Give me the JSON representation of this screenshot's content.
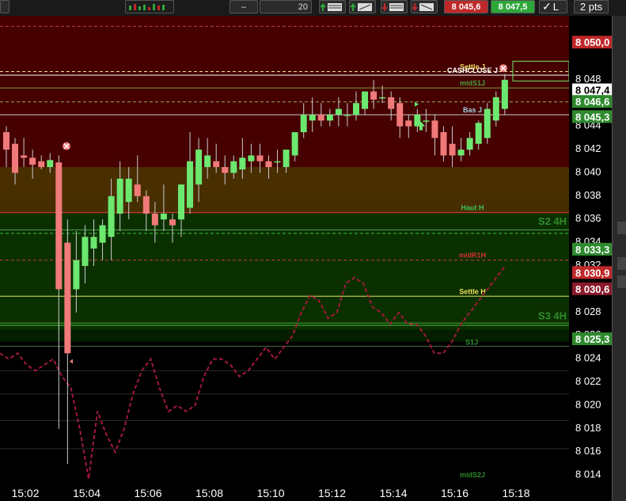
{
  "toolbar": {
    "qty_label": "20",
    "sell_price": "8 045,6",
    "buy_price": "8 047,5",
    "check_label": "L",
    "pts_label": "2 pts"
  },
  "chart_data": {
    "type": "candlestick",
    "ylim": [
      8012,
      8052
    ],
    "y_ticks": [
      8014,
      8016,
      8018,
      8020,
      8022,
      8024,
      8026,
      8028,
      8030,
      8032,
      8034,
      8036,
      8038,
      8040,
      8042,
      8044,
      8046,
      8048
    ],
    "y_tick_labels": [
      "8 014",
      "8 016",
      "8 018",
      "8 020",
      "8 022",
      "8 024",
      "8 026",
      "8 028",
      "8 030",
      "8 032",
      "8 034",
      "8 036",
      "8 038",
      "8 040",
      "8 042",
      "8 044",
      "8 046",
      "8 048"
    ],
    "x_time_labels": [
      {
        "label": "15:02",
        "t": 15.02
      },
      {
        "label": "15:04",
        "t": 15.04
      },
      {
        "label": "15:06",
        "t": 15.06
      },
      {
        "label": "15:08",
        "t": 15.08
      },
      {
        "label": "15:10",
        "t": 15.1
      },
      {
        "label": "15:12",
        "t": 15.12
      },
      {
        "label": "15:14",
        "t": 15.14
      },
      {
        "label": "15:16",
        "t": 15.16
      },
      {
        "label": "15:18",
        "t": 15.18
      }
    ],
    "candles": [
      {
        "o": 8042.0,
        "h": 8042.5,
        "l": 8039.0,
        "c": 8040.5
      },
      {
        "o": 8041.0,
        "h": 8041.5,
        "l": 8037.5,
        "c": 8038.5
      },
      {
        "o": 8040.0,
        "h": 8041.5,
        "l": 8039.0,
        "c": 8039.8
      },
      {
        "o": 8039.8,
        "h": 8040.5,
        "l": 8038.0,
        "c": 8039.2
      },
      {
        "o": 8039.5,
        "h": 8040.0,
        "l": 8038.8,
        "c": 8039.0
      },
      {
        "o": 8039.0,
        "h": 8040.2,
        "l": 8038.5,
        "c": 8039.6
      },
      {
        "o": 8039.4,
        "h": 8040.0,
        "l": 8016.5,
        "c": 8028.5
      },
      {
        "o": 8032.5,
        "h": 8034.5,
        "l": 8013.5,
        "c": 8023.0
      },
      {
        "o": 8028.5,
        "h": 8033.5,
        "l": 8026.5,
        "c": 8031.0
      },
      {
        "o": 8030.5,
        "h": 8034.0,
        "l": 8029.0,
        "c": 8033.0
      },
      {
        "o": 8032.0,
        "h": 8034.5,
        "l": 8030.5,
        "c": 8033.0
      },
      {
        "o": 8032.5,
        "h": 8034.5,
        "l": 8031.0,
        "c": 8034.0
      },
      {
        "o": 8033.0,
        "h": 8038.0,
        "l": 8031.0,
        "c": 8036.5
      },
      {
        "o": 8035.0,
        "h": 8039.5,
        "l": 8033.5,
        "c": 8038.0
      },
      {
        "o": 8036.0,
        "h": 8039.0,
        "l": 8034.5,
        "c": 8038.0
      },
      {
        "o": 8037.5,
        "h": 8040.0,
        "l": 8036.0,
        "c": 8036.5
      },
      {
        "o": 8036.5,
        "h": 8037.0,
        "l": 8033.5,
        "c": 8035.0
      },
      {
        "o": 8035.0,
        "h": 8036.0,
        "l": 8032.5,
        "c": 8034.0
      },
      {
        "o": 8034.5,
        "h": 8037.5,
        "l": 8033.5,
        "c": 8035.0
      },
      {
        "o": 8034.5,
        "h": 8035.0,
        "l": 8032.5,
        "c": 8034.0
      },
      {
        "o": 8034.5,
        "h": 8037.5,
        "l": 8033.0,
        "c": 8037.5
      },
      {
        "o": 8035.5,
        "h": 8042.0,
        "l": 8035.0,
        "c": 8039.5
      },
      {
        "o": 8037.5,
        "h": 8041.5,
        "l": 8036.0,
        "c": 8040.5
      },
      {
        "o": 8039.0,
        "h": 8041.5,
        "l": 8038.0,
        "c": 8040.0
      },
      {
        "o": 8039.5,
        "h": 8041.0,
        "l": 8038.5,
        "c": 8039.0
      },
      {
        "o": 8039.0,
        "h": 8040.0,
        "l": 8037.5,
        "c": 8038.5
      },
      {
        "o": 8038.5,
        "h": 8040.0,
        "l": 8038.0,
        "c": 8039.5
      },
      {
        "o": 8038.8,
        "h": 8041.5,
        "l": 8038.0,
        "c": 8039.8
      },
      {
        "o": 8039.5,
        "h": 8041.0,
        "l": 8038.5,
        "c": 8040.0
      },
      {
        "o": 8040.0,
        "h": 8041.0,
        "l": 8038.5,
        "c": 8039.5
      },
      {
        "o": 8039.5,
        "h": 8040.0,
        "l": 8038.0,
        "c": 8039.0
      },
      {
        "o": 8039.5,
        "h": 8040.5,
        "l": 8038.5,
        "c": 8039.5
      },
      {
        "o": 8039.0,
        "h": 8040.5,
        "l": 8038.5,
        "c": 8040.5
      },
      {
        "o": 8040.0,
        "h": 8042.0,
        "l": 8039.5,
        "c": 8042.0
      },
      {
        "o": 8042.0,
        "h": 8044.5,
        "l": 8041.5,
        "c": 8043.5
      },
      {
        "o": 8043.0,
        "h": 8045.0,
        "l": 8042.0,
        "c": 8043.5
      },
      {
        "o": 8043.5,
        "h": 8044.5,
        "l": 8042.5,
        "c": 8043.0
      },
      {
        "o": 8043.0,
        "h": 8044.0,
        "l": 8042.5,
        "c": 8043.5
      },
      {
        "o": 8043.5,
        "h": 8045.0,
        "l": 8042.5,
        "c": 8044.0
      },
      {
        "o": 8043.5,
        "h": 8044.5,
        "l": 8042.5,
        "c": 8043.5
      },
      {
        "o": 8043.5,
        "h": 8045.5,
        "l": 8043.0,
        "c": 8044.5
      },
      {
        "o": 8044.0,
        "h": 8045.5,
        "l": 8043.5,
        "c": 8045.5
      },
      {
        "o": 8045.5,
        "h": 8046.5,
        "l": 8044.0,
        "c": 8044.8
      },
      {
        "o": 8045.0,
        "h": 8046.0,
        "l": 8044.5,
        "c": 8045.0
      },
      {
        "o": 8045.0,
        "h": 8045.5,
        "l": 8043.0,
        "c": 8044.0
      },
      {
        "o": 8044.5,
        "h": 8045.0,
        "l": 8041.5,
        "c": 8042.5
      },
      {
        "o": 8043.0,
        "h": 8043.5,
        "l": 8041.5,
        "c": 8042.5
      },
      {
        "o": 8042.5,
        "h": 8044.0,
        "l": 8042.0,
        "c": 8043.5
      },
      {
        "o": 8043.0,
        "h": 8044.0,
        "l": 8042.0,
        "c": 8043.0
      },
      {
        "o": 8043.0,
        "h": 8043.5,
        "l": 8040.0,
        "c": 8041.5
      },
      {
        "o": 8042.0,
        "h": 8042.5,
        "l": 8039.5,
        "c": 8040.0
      },
      {
        "o": 8041.0,
        "h": 8042.5,
        "l": 8039.0,
        "c": 8040.0
      },
      {
        "o": 8040.0,
        "h": 8041.5,
        "l": 8039.5,
        "c": 8040.5
      },
      {
        "o": 8040.5,
        "h": 8042.0,
        "l": 8040.0,
        "c": 8041.5
      },
      {
        "o": 8041.0,
        "h": 8043.0,
        "l": 8040.5,
        "c": 8042.8
      },
      {
        "o": 8041.5,
        "h": 8044.5,
        "l": 8041.0,
        "c": 8044.0
      },
      {
        "o": 8043.0,
        "h": 8045.5,
        "l": 8042.5,
        "c": 8045.0
      },
      {
        "o": 8044.0,
        "h": 8047.0,
        "l": 8043.5,
        "c": 8046.5
      }
    ],
    "dashed_indicator": [
      8023,
      8022.5,
      8023,
      8022,
      8021.5,
      8022,
      8022.5,
      8021,
      8020,
      8016.5,
      8012.2,
      8018,
      8016,
      8014.5,
      8016.5,
      8019.5,
      8021.5,
      8022.5,
      8020,
      8018,
      8018.5,
      8018,
      8018.5,
      8021,
      8022.5,
      8022.5,
      8022,
      8021,
      8021.5,
      8022.5,
      8023.5,
      8022.5,
      8023.5,
      8024.5,
      8026.5,
      8028,
      8027.5,
      8026,
      8026.5,
      8029,
      8029.5,
      8029,
      8027,
      8026.5,
      8025.5,
      8026.5,
      8025.5,
      8025.5,
      8024.5,
      8023,
      8023,
      8024,
      8025.5,
      8026.5,
      8027.5,
      8028.5,
      8029.5,
      8030.5
    ],
    "bands": [
      {
        "from": 8036.5,
        "to": 8052,
        "color": "#4a0000"
      },
      {
        "from": 8035.0,
        "to": 8039.0,
        "color": "#4a3000"
      },
      {
        "from": 8025.0,
        "to": 8035.0,
        "color": "#0c3300"
      },
      {
        "from": 8024.0,
        "to": 8025.0,
        "color": "#062000"
      }
    ],
    "levels": [
      {
        "value": 8051.1,
        "color": "#c84040",
        "dash": true,
        "label": "",
        "label_color": "#c84040"
      },
      {
        "value": 8047.2,
        "color": "#f0e890",
        "dash": true,
        "label": "Settle J",
        "label_color": "#f0e060"
      },
      {
        "value": 8046.9,
        "color": "#ffffff",
        "dash": false,
        "label": "CASHCLOSE J",
        "label_color": "#ffffff"
      },
      {
        "value": 8045.8,
        "color": "#7a9a3a",
        "dash": false,
        "label": "midS1J",
        "label_color": "#4aa040"
      },
      {
        "value": 8044.6,
        "color": "#9aaa60",
        "dash": true,
        "label": "",
        "label_color": "#9aaa60"
      },
      {
        "value": 8043.5,
        "color": "#cccccc",
        "dash": false,
        "label": "Bas J",
        "label_color": "#a0d0e0"
      },
      {
        "value": 8035.1,
        "color": "#c84040",
        "dash": false,
        "label": "Haut H",
        "label_color": "#40c060"
      },
      {
        "value": 8033.6,
        "color": "#4aa040",
        "dash": false,
        "label": "",
        "label_color": "#4aa040"
      },
      {
        "value": 8033.3,
        "color": "#40c040",
        "dash": true,
        "label": "",
        "label_color": "#40c040"
      },
      {
        "value": 8031.0,
        "color": "#c84040",
        "dash": true,
        "label": "midR1H",
        "label_color": "#d03030"
      },
      {
        "value": 8027.9,
        "color": "#e0e060",
        "dash": false,
        "label": "Settle H",
        "label_color": "#f0e060"
      },
      {
        "value": 8025.6,
        "color": "#4aa040",
        "dash": false,
        "label": "",
        "label_color": "#4aa040"
      },
      {
        "value": 8025.4,
        "color": "#40c040",
        "dash": false,
        "label": "",
        "label_color": "#40c040"
      },
      {
        "value": 8023.6,
        "color": "#4a6a40",
        "dash": false,
        "label": "",
        "label_color": "#4a6a40"
      },
      {
        "value": 8021.5,
        "color": "#2a2a2a",
        "dash": false,
        "label": "",
        "label_color": "#2a2a2a"
      },
      {
        "value": 8019.5,
        "color": "#2a2a2a",
        "dash": false,
        "label": "",
        "label_color": "#2a2a2a"
      },
      {
        "value": 8017.2,
        "color": "#2a2a2a",
        "dash": false,
        "label": "",
        "label_color": "#2a2a2a"
      },
      {
        "value": 8014.8,
        "color": "#2a2a2a",
        "dash": false,
        "label": "",
        "label_color": "#2a2a2a"
      }
    ],
    "inline_labels": [
      {
        "text": "S2 4H",
        "value": 8034.3,
        "color": "#2e8a2e"
      },
      {
        "text": "S3 4H",
        "value": 8026.2,
        "color": "#2e8a2e"
      },
      {
        "text": "S1J",
        "value": 8024.0,
        "color": "#2e8a2e"
      },
      {
        "text": "midS2J",
        "value": 8012.6,
        "color": "#2e8a2e"
      }
    ],
    "price_tags": [
      {
        "label": "8 050,0",
        "value": 8051.1,
        "bg": "#c0282a",
        "fg": "#ffffff"
      },
      {
        "label": "8 047,4",
        "value": 8047.0,
        "bg": "#ffffff",
        "fg": "#000000"
      },
      {
        "label": "8 046,6",
        "value": 8046.0,
        "bg": "#2e8a2e",
        "fg": "#ffffff"
      },
      {
        "label": "8 045,3",
        "value": 8044.7,
        "bg": "#2e8a2e",
        "fg": "#ffffff"
      },
      {
        "label": "8 033,3",
        "value": 8033.3,
        "bg": "#2e8a2e",
        "fg": "#ffffff"
      },
      {
        "label": "8 030,9",
        "value": 8031.3,
        "bg": "#c0282a",
        "fg": "#ffffff"
      },
      {
        "label": "8 030,6",
        "value": 8029.9,
        "bg": "#8a1a2a",
        "fg": "#ffffff"
      },
      {
        "label": "8 025,3",
        "value": 8025.6,
        "bg": "#2e8a2e",
        "fg": "#ffffff"
      }
    ],
    "colors": {
      "up": "#6ce870",
      "down": "#f07a7a",
      "wick": "#cccccc",
      "indicator": "#a01a3a",
      "axis_text": "#ffffff"
    }
  }
}
